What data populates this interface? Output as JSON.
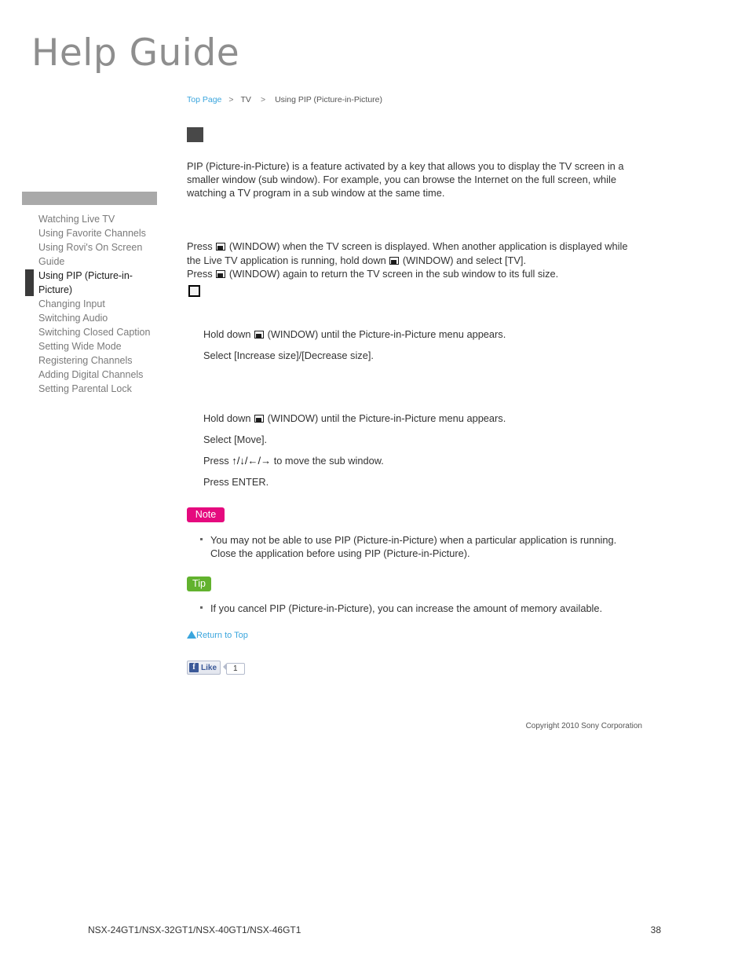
{
  "site": {
    "logo": "Help Guide"
  },
  "breadcrumb": {
    "top_page": "Top Page",
    "separator": ">",
    "section": "TV",
    "current": "Using PIP (Picture-in-Picture)"
  },
  "sidebar": {
    "items": [
      {
        "label": "Watching Live TV",
        "active": false
      },
      {
        "label": "Using Favorite Channels",
        "active": false
      },
      {
        "label": "Using Rovi's On Screen Guide",
        "active": false
      },
      {
        "label": "Using PIP (Picture-in-Picture)",
        "active": true
      },
      {
        "label": "Changing Input",
        "active": false
      },
      {
        "label": "Switching Audio",
        "active": false
      },
      {
        "label": "Switching Closed Caption",
        "active": false
      },
      {
        "label": "Setting Wide Mode",
        "active": false
      },
      {
        "label": "Registering Channels",
        "active": false
      },
      {
        "label": "Adding Digital Channels",
        "active": false
      },
      {
        "label": "Setting Parental Lock",
        "active": false
      }
    ]
  },
  "main": {
    "intro": "PIP (Picture-in-Picture) is a feature activated by a key that allows you to display the TV screen in a smaller window (sub window). For example, you can browse the Internet on the full screen, while watching a TV program in a sub window at the same time.",
    "press": {
      "line1_a": "Press",
      "line1_b": "(WINDOW) when the TV screen is displayed. When another application is displayed while the Live TV application is running, hold down",
      "line1_c": "(WINDOW) and select [TV].",
      "line2_a": "Press",
      "line2_b": "(WINDOW) again to return the TV screen in the sub window to its full size."
    },
    "group1": {
      "step1_a": "Hold down",
      "step1_b": "(WINDOW) until the Picture-in-Picture menu appears.",
      "step2": "Select [Increase size]/[Decrease size]."
    },
    "group2": {
      "step1_a": "Hold down",
      "step1_b": "(WINDOW) until the Picture-in-Picture menu appears.",
      "step2": "Select [Move].",
      "step3_a": "Press",
      "step3_arrows": "↑/↓/←/→",
      "step3_b": "to move the sub window.",
      "step4": "Press ENTER."
    },
    "note": {
      "badge": "Note",
      "text": "You may not be able to use PIP (Picture-in-Picture) when a particular application is running. Close the application before using PIP (Picture-in-Picture)."
    },
    "tip": {
      "badge": "Tip",
      "text": "If you cancel PIP (Picture-in-Picture), you can increase the amount of memory available."
    },
    "return_to_top": "Return to Top",
    "facebook": {
      "f_glyph": "f",
      "like_label": "Like",
      "count": "1"
    },
    "copyright": "Copyright 2010 Sony Corporation"
  },
  "footer": {
    "models": "NSX-24GT1/NSX-32GT1/NSX-40GT1/NSX-46GT1",
    "page_number": "38"
  },
  "colors": {
    "link": "#3aa5dd",
    "note_badge": "#e50a7e",
    "tip_badge": "#62b22e",
    "sidebar_header": "#a9a9a9",
    "active_marker": "#3a3a3a"
  }
}
